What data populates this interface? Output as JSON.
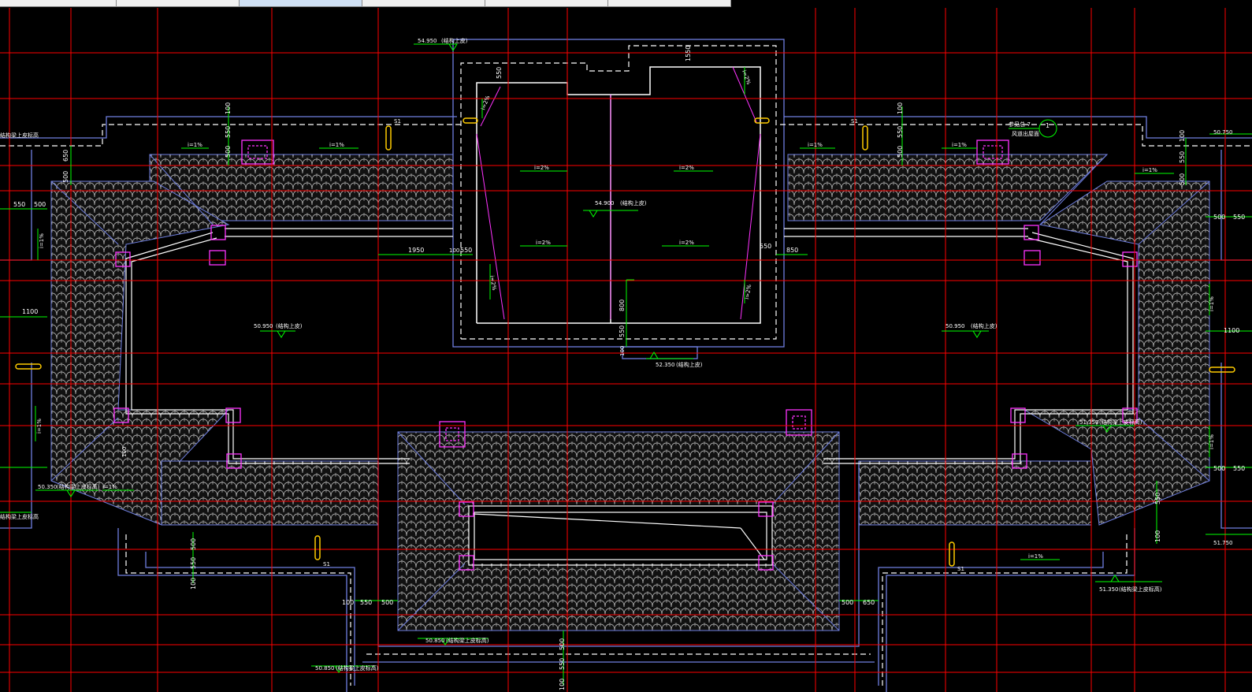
{
  "tabs": [
    {
      "label": "",
      "active": false
    },
    {
      "label": "",
      "active": false
    },
    {
      "label": "",
      "active": true
    },
    {
      "label": "",
      "active": false
    },
    {
      "label": "",
      "active": false
    },
    {
      "label": "",
      "active": false
    }
  ],
  "colors": {
    "background": "#000000",
    "axis_grid": "#ff0000",
    "outline": "#6f7fe0",
    "wall": "#ffffff",
    "dim": "#00ff00",
    "accent": "#ff33ff",
    "vent": "#ffff00"
  },
  "drawing": {
    "dims": {
      "d100": "100",
      "d550": "550",
      "d500": "500",
      "d650": "650",
      "d1950": "1950",
      "d850": "850",
      "d800": "800",
      "d1100": "1100",
      "d1550": "1550"
    },
    "slopes": {
      "i1": "i=1%",
      "i2": "i=2%"
    },
    "elevations": {
      "e1": "50.950",
      "e1_note": "(结构上皮)",
      "e2": "54.900",
      "e2_note": "(结构上皮)",
      "e3": "50.950",
      "e3_note": "(结构上皮)",
      "e4": "52.350",
      "e4_note": "(结构上皮)",
      "e5": "50.350",
      "e5_note": "(结构梁上皮标高)",
      "e6": "51.350",
      "e6_note": "(结构梁上皮标高)",
      "e7": "51.350",
      "e7_note": "(结构梁上皮标高)",
      "e8": "50.850",
      "e8_note": "(结构梁上皮标高)",
      "e9": "50.750",
      "e10": "51.750",
      "e11": "54.950",
      "e11_note": "(结构上皮)",
      "e12": "50.850",
      "e12_note": "(结构梁上皮标高)",
      "e13_note": "结构梁上皮标高"
    },
    "labels": {
      "s1": "S1",
      "detail_ref": "参见总-7",
      "detail_note": "风道出屋面",
      "detail_num": "1"
    }
  }
}
